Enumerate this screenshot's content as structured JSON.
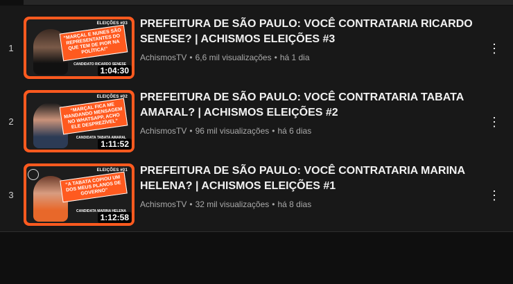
{
  "playlist": {
    "items": [
      {
        "index": "1",
        "title": "PREFEITURA DE SÃO PAULO: VOCÊ CONTRATARIA RICARDO SENESE? | ACHISMOS ELEIÇÕES #3",
        "channel": "AchismosTV",
        "views": "6,6 mil visualizações",
        "age": "há 1 dia",
        "duration": "1:04:30",
        "thumb_tag": "ELEIÇÕES #03",
        "thumb_quote": "“MARÇAL E NUNES SÃO REPRESENTANTES DO QUE TEM DE PIOR NA POLÍTICA!”",
        "thumb_guest": "Candidato RICARDO SENESE"
      },
      {
        "index": "2",
        "title": "PREFEITURA DE SÃO PAULO: VOCÊ CONTRATARIA TABATA AMARAL? | ACHISMOS ELEIÇÕES #2",
        "channel": "AchismosTV",
        "views": "96 mil visualizações",
        "age": "há 6 dias",
        "duration": "1:11:52",
        "thumb_tag": "ELEIÇÕES #02",
        "thumb_quote": "“MARÇAL FICA ME MANDANDO MENSAGEM NO WHATSAPP, ACHO ELE DESPREZÍVEL”",
        "thumb_guest": "Candidata TABATA AMARAL"
      },
      {
        "index": "3",
        "title": "PREFEITURA DE SÃO PAULO: VOCÊ CONTRATARIA MARINA HELENA? | ACHISMOS ELEIÇÕES #1",
        "channel": "AchismosTV",
        "views": "32 mil visualizações",
        "age": "há 8 dias",
        "duration": "1:12:58",
        "thumb_tag": "ELEIÇÕES #01",
        "thumb_quote": "“A TABATA COPIOU UM DOS MEUS PLANOS DE GOVERNO”",
        "thumb_guest": "Candidata MARINA HELENA"
      }
    ]
  },
  "colors": {
    "background": "#0f0f0f",
    "panel": "#181818",
    "accent_orange": "#ff5a1f",
    "meta_text": "#aaaaaa"
  },
  "icons": {
    "menu": "more-vert-icon"
  }
}
